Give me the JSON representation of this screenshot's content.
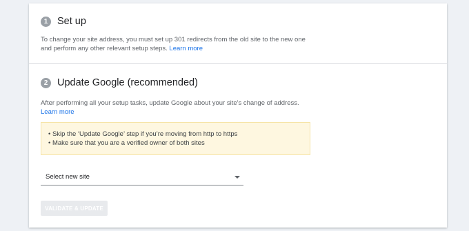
{
  "steps": [
    {
      "number": "1",
      "title": "Set up",
      "description": "To change your site address, you must set up 301 redirects from the old site to the new one and perform any other relevant setup steps.",
      "link": "Learn more"
    },
    {
      "number": "2",
      "title": "Update Google (recommended)",
      "description": "After performing all your setup tasks, update Google about your site's change of address.",
      "link": "Learn more"
    }
  ],
  "notice": {
    "items": [
      "• Skip the ‘Update Google’ step if you’re moving from http to https",
      "• Make sure that you are a verified owner of both sites"
    ]
  },
  "site_select": {
    "value": "Select new site"
  },
  "validate_button": {
    "label": "VALIDATE & UPDATE"
  },
  "colors": {
    "background": "#eef1f5",
    "link": "#1a73e8",
    "notice_bg": "#fef7e0",
    "badge": "#9aa0a6"
  },
  "icons": {
    "dropdown": "caret-down-icon"
  }
}
